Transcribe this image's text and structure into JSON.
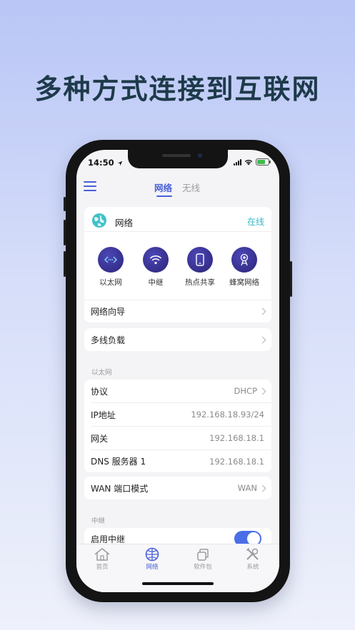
{
  "headline": "多种方式连接到互联网",
  "status_bar": {
    "time": "14:50"
  },
  "top_tabs": [
    {
      "label": "网络"
    },
    {
      "label": "无线"
    }
  ],
  "network_card": {
    "title": "网络",
    "status": "在线",
    "modes": [
      {
        "label": "以太网",
        "icon": "ethernet-icon"
      },
      {
        "label": "中继",
        "icon": "wifi-icon"
      },
      {
        "label": "热点共享",
        "icon": "phone-icon"
      },
      {
        "label": "蜂窝网络",
        "icon": "cellular-icon"
      }
    ],
    "wizard_label": "网络向导"
  },
  "multi_wan": {
    "label": "多线负载"
  },
  "ethernet_section": {
    "title": "以太网",
    "rows": [
      {
        "label": "协议",
        "value": "DHCP",
        "chevron": true
      },
      {
        "label": "IP地址",
        "value": "192.168.18.93/24",
        "chevron": false
      },
      {
        "label": "网关",
        "value": "192.168.18.1",
        "chevron": false
      },
      {
        "label": "DNS 服务器 1",
        "value": "192.168.18.1",
        "chevron": false
      }
    ]
  },
  "wan_port": {
    "label": "WAN 端口模式",
    "value": "WAN"
  },
  "relay_section": {
    "title": "中继",
    "enable_label": "启用中继",
    "enabled": true
  },
  "tabbar": [
    {
      "label": "首页",
      "icon": "home-icon"
    },
    {
      "label": "网络",
      "icon": "globe-icon"
    },
    {
      "label": "软件包",
      "icon": "package-icon"
    },
    {
      "label": "系统",
      "icon": "tools-icon"
    }
  ],
  "colors": {
    "accent": "#4a5fd8",
    "online": "#38b8c4",
    "mode_circle": "#2b2477",
    "toggle": "#4a6ee8"
  }
}
